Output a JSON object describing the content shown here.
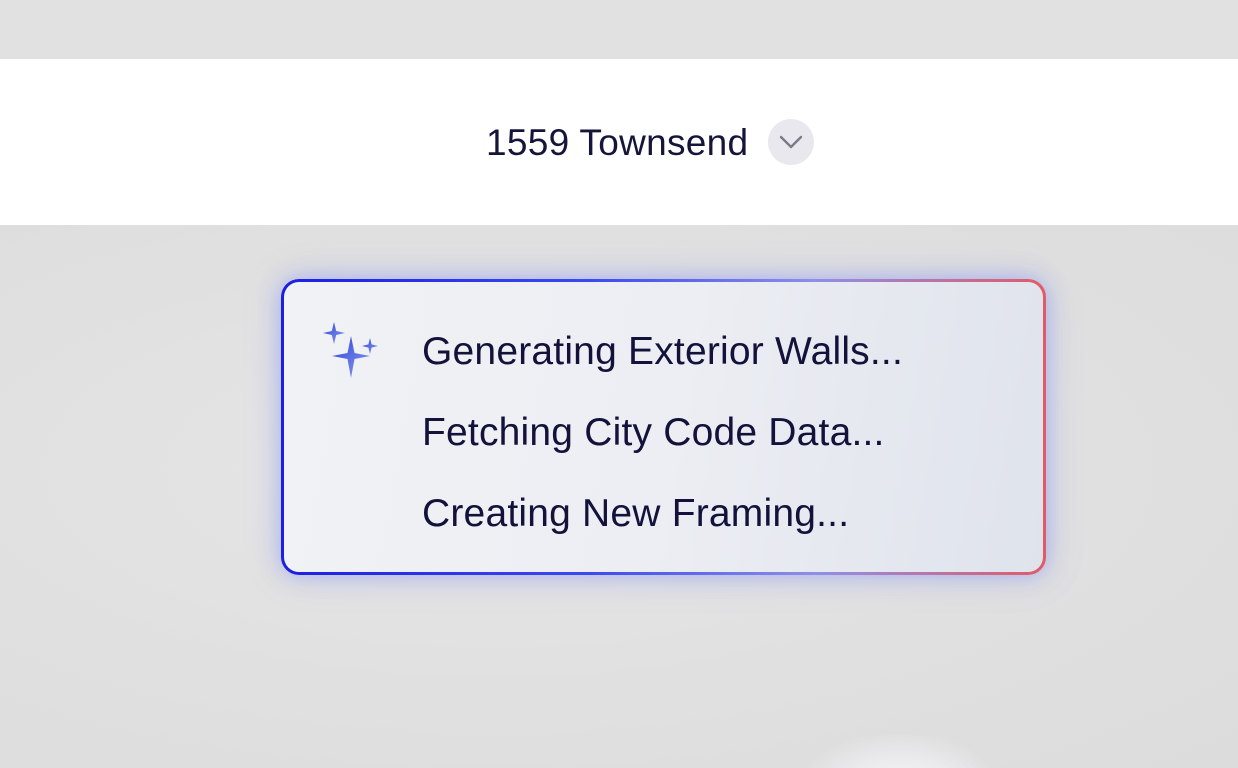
{
  "header": {
    "project_name": "1559 Townsend"
  },
  "icons": {
    "project_chevron": "chevron-down-icon",
    "status_sparkle": "sparkle-icon"
  },
  "status_panel": {
    "items": [
      "Generating Exterior Walls...",
      "Fetching City Code Data...",
      "Creating New Framing..."
    ]
  },
  "colors": {
    "header_text": "#15153a",
    "panel_border_start": "#1d1fe0",
    "panel_border_end": "#e25a66",
    "sparkle": "#4a5fd8"
  }
}
